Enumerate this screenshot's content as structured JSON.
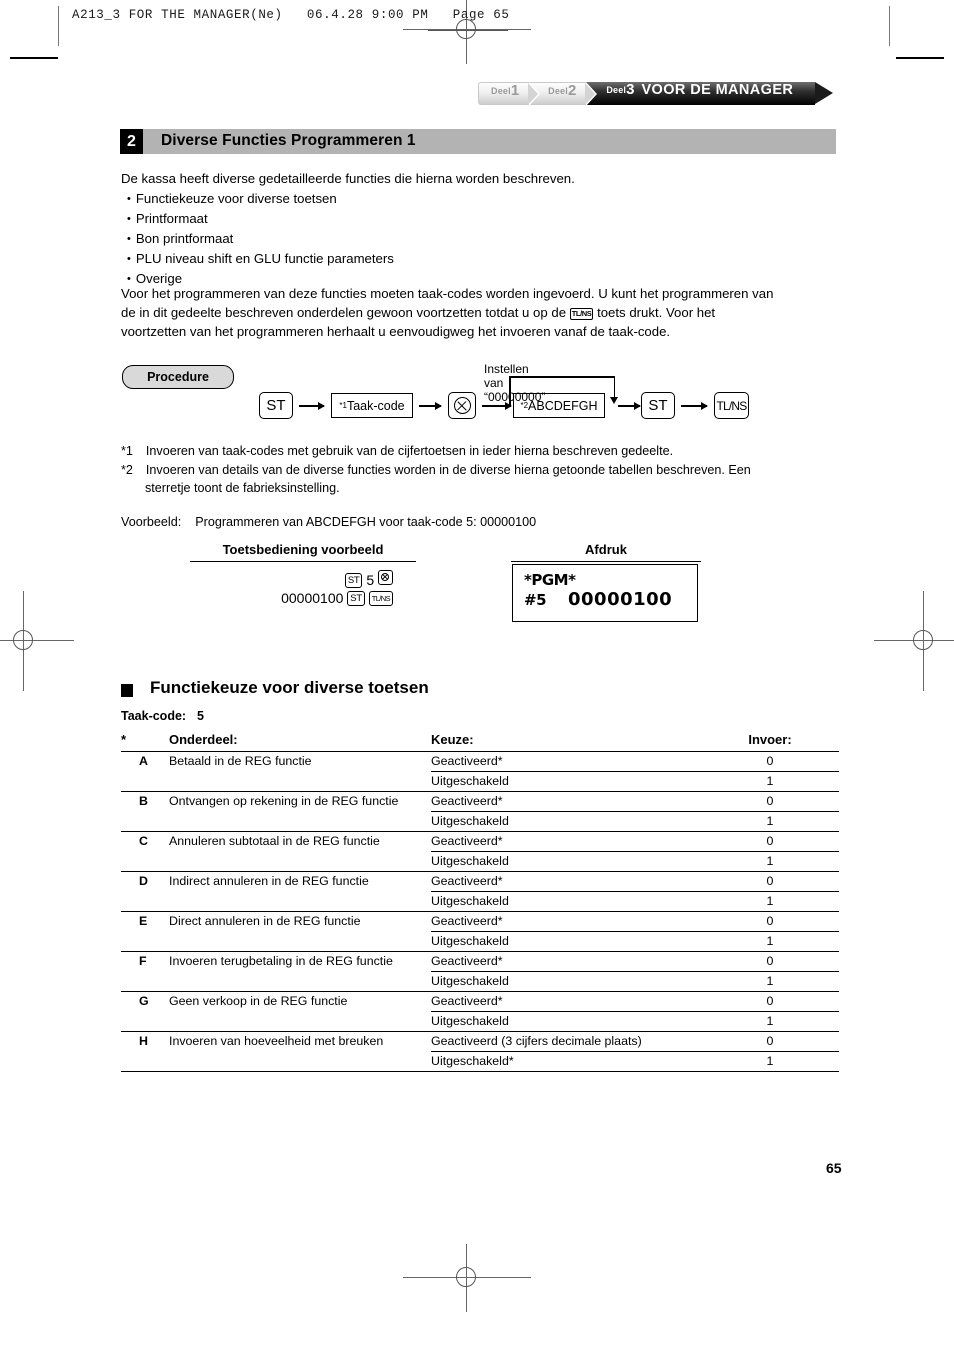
{
  "print_header": {
    "text": "A213_3 FOR THE MANAGER(Ne)   06.4.28 9:00 PM   Page 65"
  },
  "tabs": [
    {
      "label": "Deel",
      "number": "1",
      "title": "",
      "active": false
    },
    {
      "label": "Deel",
      "number": "2",
      "title": "",
      "active": false
    },
    {
      "label": "Deel",
      "number": "3",
      "title": "VOOR DE MANAGER",
      "active": true
    }
  ],
  "section": {
    "number": "2",
    "title": "Diverse Functies Programmeren 1"
  },
  "intro": {
    "lead": "De kassa heeft diverse gedetailleerde functies die hierna worden beschreven.",
    "bullets": [
      "Functiekeuze voor diverse toetsen",
      "Printformaat",
      "Bon printformaat",
      "PLU niveau shift en GLU functie parameters",
      "Overige"
    ],
    "para_line1": "Voor het programmeren van deze functies moeten taak-codes worden ingevoerd. U kunt het programmeren van",
    "para_line2_a": "de in dit gedeelte beschreven onderdelen gewoon voortzetten totdat u op de",
    "para_line2_key": "TL/NS",
    "para_line2_b": "toets drukt. Voor het",
    "para_line3": "voortzetten van het programmeren herhaalt u eenvoudigweg het invoeren vanaf de taak-code."
  },
  "procedure": {
    "pill_label": "Procedure",
    "annotation": "Instellen van “00000000”",
    "nodes": {
      "st1": "ST",
      "taakcode_sup": "*1",
      "taakcode": "Taak-code",
      "multiply_icon": "multiply-key-icon",
      "abcdefgh_sup": "*2",
      "abcdefgh": "ABCDEFGH",
      "st2": "ST",
      "tlns": "TL/NS"
    }
  },
  "footnotes": [
    {
      "marker": "*1",
      "text": "Invoeren van taak-codes met gebruik van de cijfertoetsen in ieder hierna beschreven gedeelte."
    },
    {
      "marker": "*2",
      "text": "Invoeren van details van de diverse functies worden in de diverse hierna getoonde tabellen beschreven. Een",
      "text_cont": "sterretje toont de fabrieksinstelling."
    }
  ],
  "example": {
    "intro_label": "Voorbeeld:",
    "intro_text": "Programmeren van ABCDEFGH voor taak-code 5: 00000100",
    "col_left_header": "Toetsbediening voorbeeld",
    "col_right_header": "Afdruk",
    "key_seq_line1": {
      "st": "ST",
      "digit": "5",
      "multiply": "multiply-key-icon"
    },
    "key_seq_line2": {
      "value": "00000100",
      "st": "ST",
      "tlns": "TL/NS"
    },
    "printout": {
      "line1": "*PGM*",
      "line2_label": "#5",
      "line2_value": "00000100"
    }
  },
  "subsection": {
    "title": "Functiekeuze voor diverse toetsen",
    "taakcode_label": "Taak-code:",
    "taakcode_value": "5"
  },
  "table": {
    "headers": {
      "star": "*",
      "onderdeel": "Onderdeel:",
      "keuze": "Keuze:",
      "invoer": "Invoer:"
    },
    "rows": [
      {
        "letter": "A",
        "desc": "Betaald in de REG functie",
        "options": [
          {
            "keuze": "Geactiveerd*",
            "invoer": "0"
          },
          {
            "keuze": "Uitgeschakeld",
            "invoer": "1"
          }
        ]
      },
      {
        "letter": "B",
        "desc": "Ontvangen op rekening in de REG functie",
        "options": [
          {
            "keuze": "Geactiveerd*",
            "invoer": "0"
          },
          {
            "keuze": "Uitgeschakeld",
            "invoer": "1"
          }
        ]
      },
      {
        "letter": "C",
        "desc": "Annuleren subtotaal in de REG functie",
        "options": [
          {
            "keuze": "Geactiveerd*",
            "invoer": "0"
          },
          {
            "keuze": "Uitgeschakeld",
            "invoer": "1"
          }
        ]
      },
      {
        "letter": "D",
        "desc": "Indirect annuleren in de REG functie",
        "options": [
          {
            "keuze": "Geactiveerd*",
            "invoer": "0"
          },
          {
            "keuze": "Uitgeschakeld",
            "invoer": "1"
          }
        ]
      },
      {
        "letter": "E",
        "desc": "Direct annuleren in de REG functie",
        "options": [
          {
            "keuze": "Geactiveerd*",
            "invoer": "0"
          },
          {
            "keuze": "Uitgeschakeld",
            "invoer": "1"
          }
        ]
      },
      {
        "letter": "F",
        "desc": "Invoeren terugbetaling in de REG functie",
        "options": [
          {
            "keuze": "Geactiveerd*",
            "invoer": "0"
          },
          {
            "keuze": "Uitgeschakeld",
            "invoer": "1"
          }
        ]
      },
      {
        "letter": "G",
        "desc": "Geen verkoop in de REG functie",
        "options": [
          {
            "keuze": "Geactiveerd*",
            "invoer": "0"
          },
          {
            "keuze": "Uitgeschakeld",
            "invoer": "1"
          }
        ]
      },
      {
        "letter": "H",
        "desc": "Invoeren van hoeveelheid met breuken",
        "options": [
          {
            "keuze": "Geactiveerd (3 cijfers decimale plaats)",
            "invoer": "0"
          },
          {
            "keuze": "Uitgeschakeld*",
            "invoer": "1"
          }
        ]
      }
    ]
  },
  "page_number": "65"
}
